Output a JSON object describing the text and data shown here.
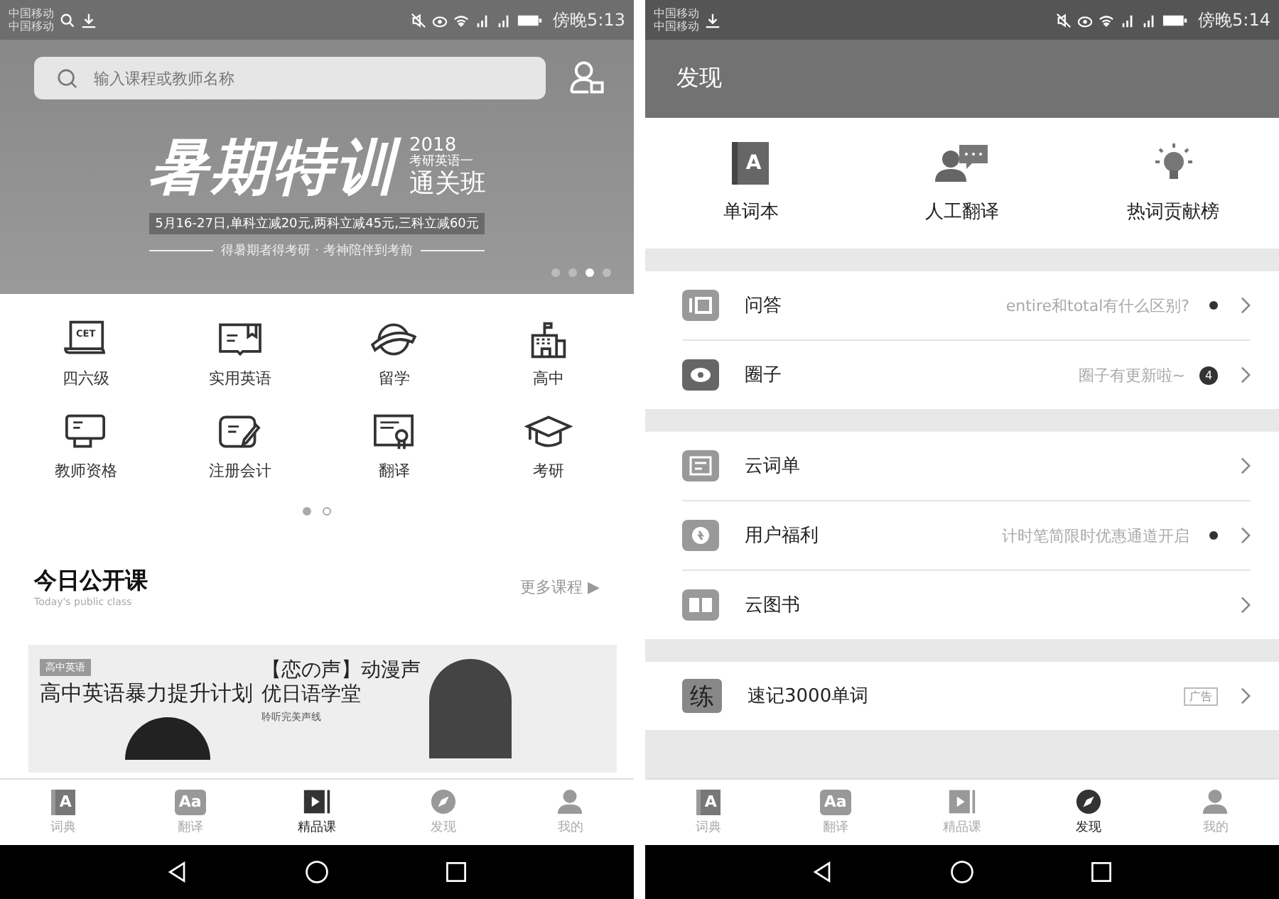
{
  "left_screen": {
    "status_bar": {
      "carriers": [
        "中国移动",
        "中国移动"
      ],
      "time": "傍晚5:13"
    },
    "search": {
      "placeholder": "输入课程或教师名称"
    },
    "banner": {
      "title": "暑期特训",
      "year": "2018",
      "subtitle": "考研英语一",
      "course": "通关班",
      "promo": "5月16-27日,单科立减20元,两科立减45元,三科立减60元",
      "tagline": "得暑期者得考研 · 考神陪伴到考前",
      "dots": [
        {
          "selected": false
        },
        {
          "selected": false
        },
        {
          "selected": true
        },
        {
          "selected": false
        }
      ]
    },
    "categories": [
      {
        "label": "四六级",
        "icon_text": "CET"
      },
      {
        "label": "实用英语"
      },
      {
        "label": "留学"
      },
      {
        "label": "高中"
      },
      {
        "label": "教师资格"
      },
      {
        "label": "注册会计"
      },
      {
        "label": "翻译"
      },
      {
        "label": "考研"
      }
    ],
    "category_pages": [
      {
        "selected": true
      },
      {
        "selected": false
      }
    ],
    "section": {
      "title": "今日公开课",
      "subtitle": "Today's public class",
      "more": "更多课程 ▶"
    },
    "promo_card": {
      "tag": "高中英语",
      "title": "高中英语暴力提升计划",
      "second_title": "【恋の声】动漫声优日语学堂",
      "second_subtitle": "聆听完美声线"
    },
    "nav": [
      {
        "label": "词典",
        "glyph": "A",
        "selected": false
      },
      {
        "label": "翻译",
        "glyph": "Aa",
        "selected": false
      },
      {
        "label": "精品课",
        "selected": true
      },
      {
        "label": "发现",
        "selected": false
      },
      {
        "label": "我的",
        "selected": false
      }
    ]
  },
  "right_screen": {
    "status_bar": {
      "carriers": [
        "中国移动",
        "中国移动"
      ],
      "time": "傍晚5:14"
    },
    "header": {
      "title": "发现"
    },
    "shortcuts": [
      {
        "label": "单词本",
        "glyph": "A"
      },
      {
        "label": "人工翻译"
      },
      {
        "label": "热词贡献榜"
      }
    ],
    "groups": [
      {
        "rows": [
          {
            "title": "问答",
            "detail": "entire和total有什么区别?",
            "dot": true
          },
          {
            "title": "圈子",
            "detail": "圈子有更新啦~",
            "badge": "4",
            "dot": false
          }
        ]
      },
      {
        "rows": [
          {
            "title": "云词单",
            "dot": false
          },
          {
            "title": "用户福利",
            "detail": "计时笔简限时优惠通道开启",
            "dot": true
          },
          {
            "title": "云图书",
            "dot": false
          }
        ]
      },
      {
        "rows": [
          {
            "title": "速记3000单词",
            "glyph": "练",
            "tag": "广告",
            "dot": false
          }
        ]
      }
    ],
    "nav": [
      {
        "label": "词典",
        "glyph": "A",
        "selected": false
      },
      {
        "label": "翻译",
        "glyph": "Aa",
        "selected": false
      },
      {
        "label": "精品课",
        "selected": false
      },
      {
        "label": "发现",
        "selected": true
      },
      {
        "label": "我的",
        "selected": false
      }
    ]
  }
}
